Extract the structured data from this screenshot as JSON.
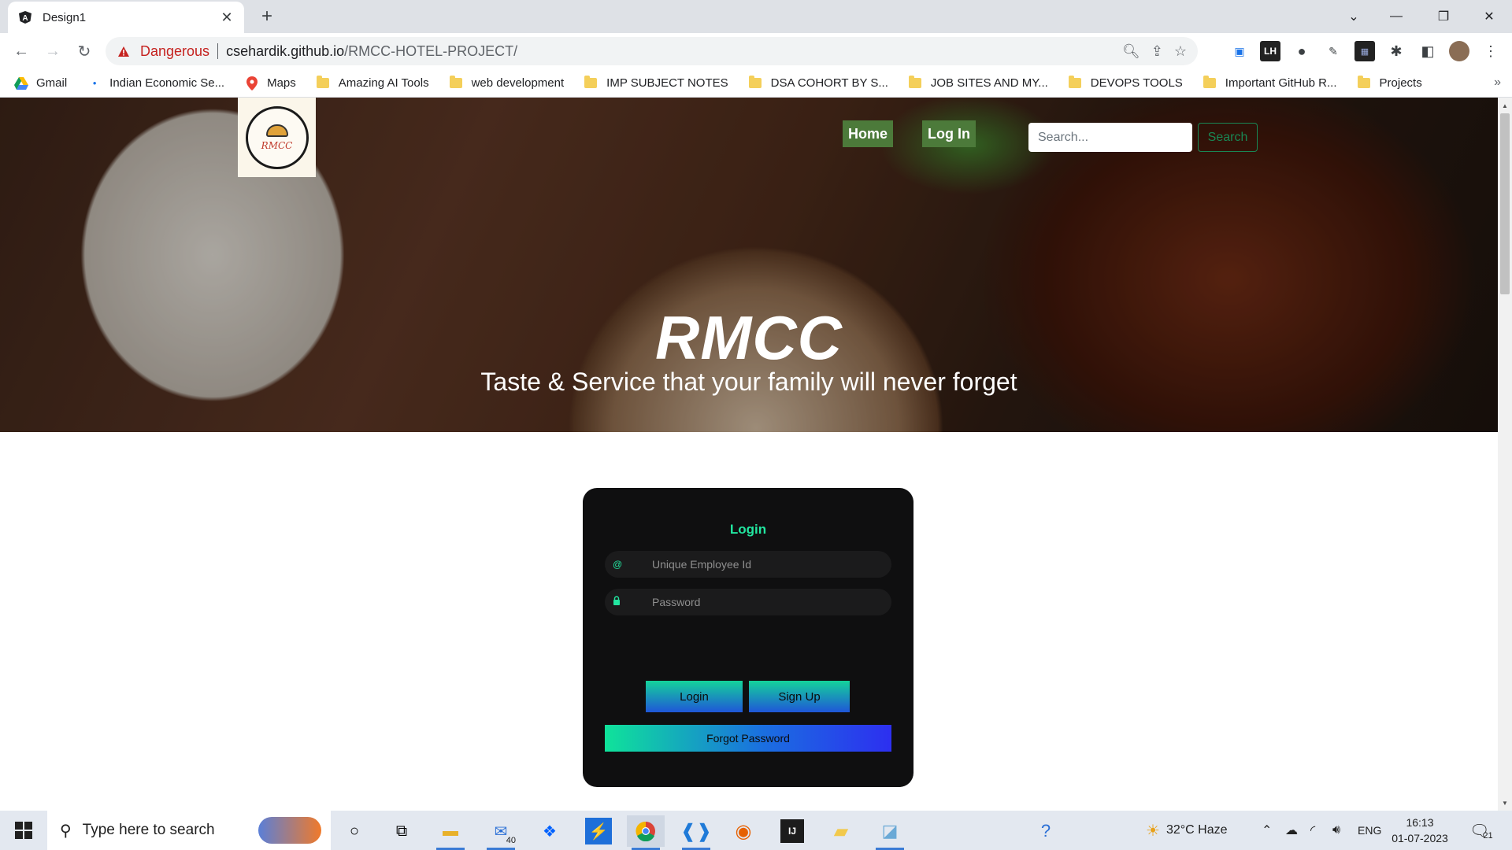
{
  "browser": {
    "tab_title": "Design1",
    "url_warning": "Dangerous",
    "url_host": "csehardik.github.io",
    "url_path": "/RMCC-HOTEL-PROJECT/",
    "bookmarks": [
      "Gmail",
      "Indian Economic Se...",
      "Maps",
      "Amazing AI Tools",
      "web development",
      "IMP SUBJECT NOTES",
      "DSA COHORT BY S...",
      "JOB SITES AND MY...",
      "DEVOPS TOOLS",
      "Important GitHub R...",
      "Projects"
    ]
  },
  "header": {
    "logo_text": "RMCC",
    "nav": {
      "home": "Home",
      "login": "Log In"
    },
    "search_placeholder": "Search...",
    "search_button": "Search"
  },
  "hero": {
    "title": "RMCC",
    "subtitle": "Taste & Service that your family will never forget"
  },
  "login": {
    "title": "Login",
    "employee_id_placeholder": "Unique Employee Id",
    "password_placeholder": "Password",
    "login_button": "Login",
    "signup_button": "Sign Up",
    "forgot_button": "Forgot Password",
    "employee_icon": "@"
  },
  "taskbar": {
    "search_placeholder": "Type here to search",
    "mail_badge": "40",
    "weather": "32°C  Haze",
    "language": "ENG",
    "time": "16:13",
    "date": "01-07-2023",
    "notifications": "21"
  },
  "colors": {
    "accent_green": "#22e6a0",
    "nav_green": "#4c7a3a",
    "danger_red": "#c5221f"
  }
}
